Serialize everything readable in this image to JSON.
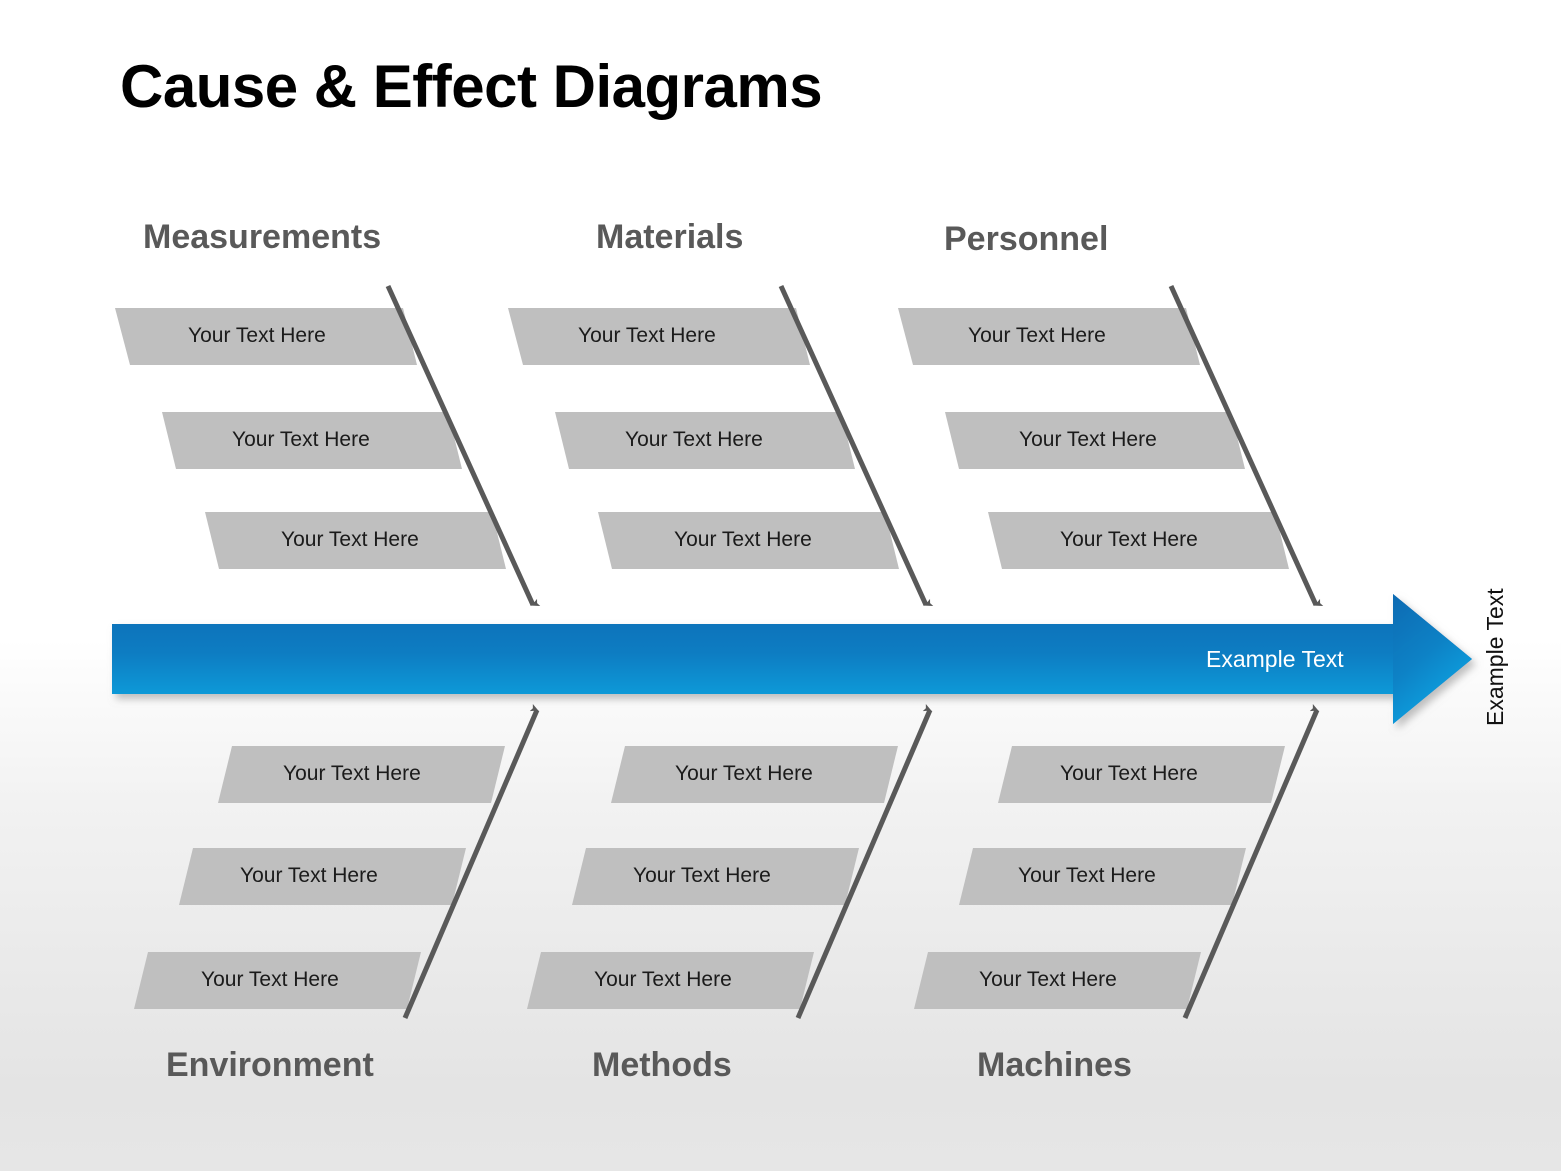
{
  "page": {
    "title": "Cause & Effect Diagrams"
  },
  "colors": {
    "title_text": "#000000",
    "category_text": "#595959",
    "bone_line": "#595959",
    "label_fill": "#bfbfbf",
    "label_text": "#1b1b1b",
    "spine_top": "#0b6cb3",
    "spine_bottom": "#11a6e2",
    "spine_text": "#ffffff",
    "effect_text": "#111111",
    "background_top": "#ffffff",
    "background_bottom": "#e4e4e4"
  },
  "spine": {
    "label": "Example Text",
    "effect_label": "Example Text"
  },
  "categories": {
    "top": [
      {
        "name": "Measurements",
        "labels": [
          "Your Text Here",
          "Your Text Here",
          "Your Text Here"
        ]
      },
      {
        "name": "Materials",
        "labels": [
          "Your Text Here",
          "Your Text Here",
          "Your Text Here"
        ]
      },
      {
        "name": "Personnel",
        "labels": [
          "Your Text Here",
          "Your Text Here",
          "Your Text Here"
        ]
      }
    ],
    "bottom": [
      {
        "name": "Environment",
        "labels": [
          "Your Text Here",
          "Your Text Here",
          "Your Text Here"
        ]
      },
      {
        "name": "Methods",
        "labels": [
          "Your Text Here",
          "Your Text Here",
          "Your Text Here"
        ]
      },
      {
        "name": "Machines",
        "labels": [
          "Your Text Here",
          "Your Text Here",
          "Your Text Here"
        ]
      }
    ]
  }
}
